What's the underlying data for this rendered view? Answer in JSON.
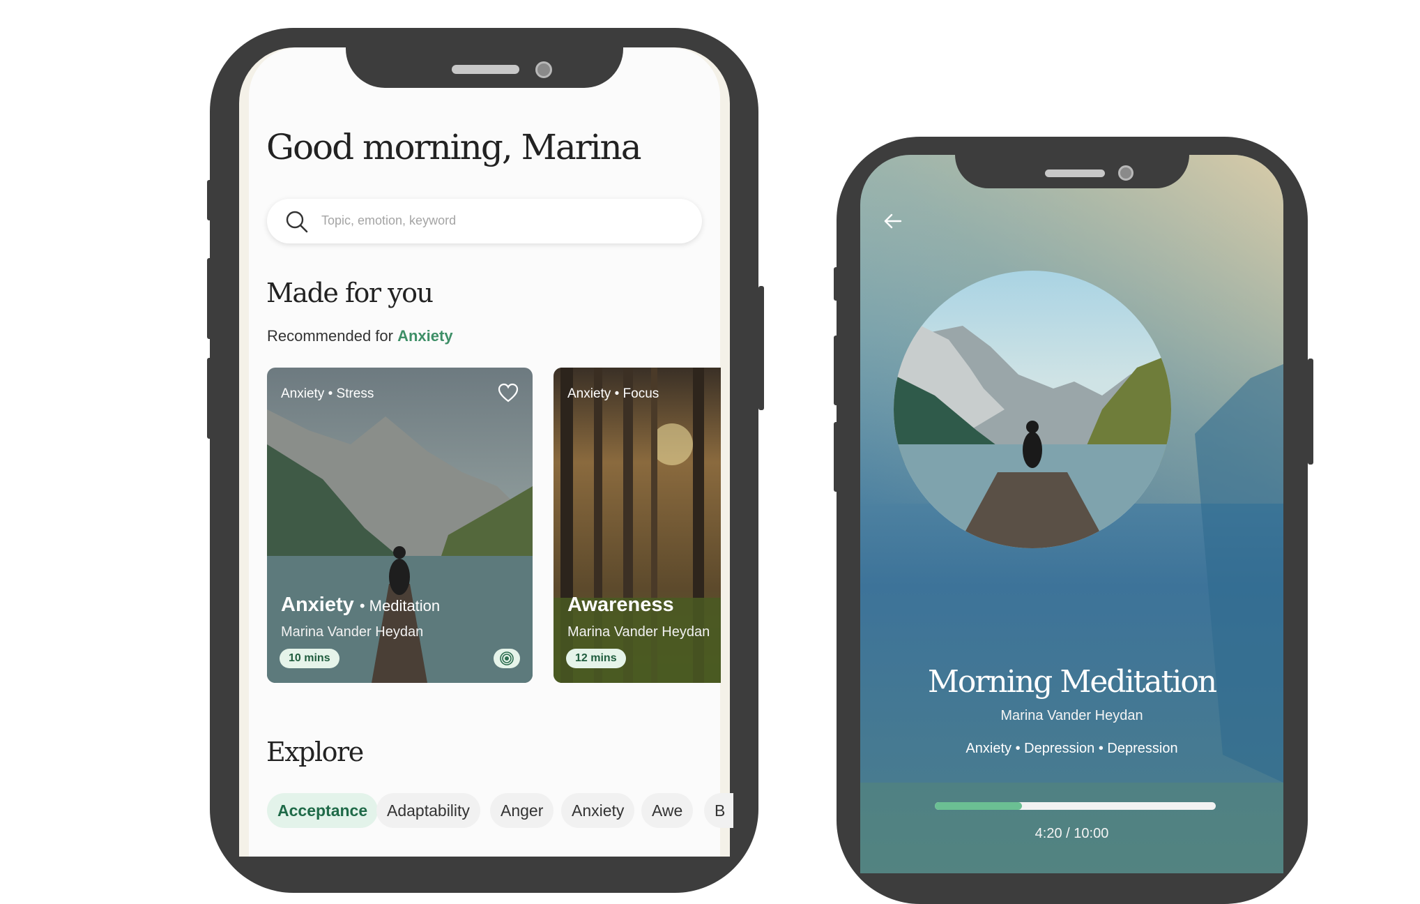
{
  "home": {
    "greeting": "Good morning, Marina",
    "search_placeholder": "Topic, emotion, keyword",
    "made_for_you": "Made for you",
    "recommended_prefix": "Recommended for",
    "recommended_topic": "Anxiety",
    "cards": [
      {
        "tags": "Anxiety • Stress",
        "title": "Anxiety",
        "subtitle": "• Meditation",
        "author": "Marina Vander Heydan",
        "duration": "10 mins"
      },
      {
        "tags": "Anxiety • Focus",
        "title": "Awareness",
        "author": "Marina Vander Heydan",
        "duration": "12 mins"
      }
    ],
    "explore": "Explore",
    "chips": [
      "Acceptance",
      "Adaptability",
      "Anger",
      "Anxiety",
      "Awe",
      "B"
    ],
    "accent_color": "#3e8f67"
  },
  "player": {
    "title": "Morning Meditation",
    "author": "Marina Vander Heydan",
    "tags": "Anxiety  •  Depression   •  Depression",
    "time": "4:20 / 10:00",
    "progress_fraction": 0.31,
    "back_icon": "arrow-left-icon"
  }
}
